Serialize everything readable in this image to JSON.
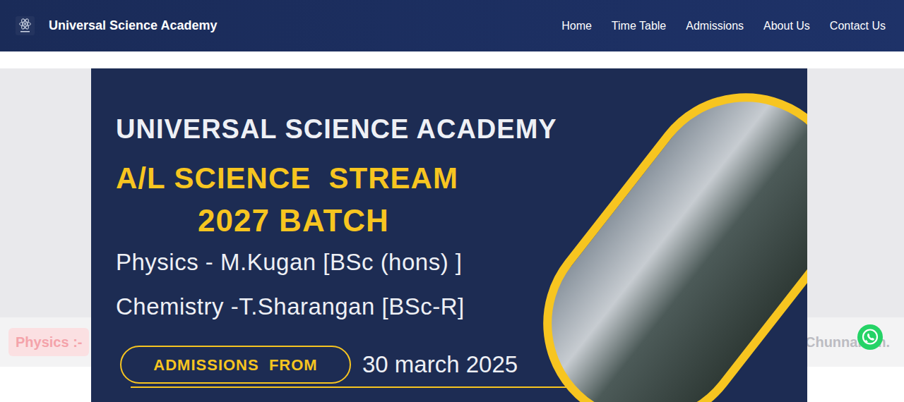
{
  "nav": {
    "brand": "Universal Science Academy",
    "links": [
      {
        "label": "Home"
      },
      {
        "label": "Time Table"
      },
      {
        "label": "Admissions"
      },
      {
        "label": "About Us"
      },
      {
        "label": "Contact Us"
      }
    ]
  },
  "marquee": {
    "badge": "Physics :-",
    "trailing": "Chunnakam."
  },
  "banner": {
    "title": "UNIVERSAL SCIENCE ACADEMY",
    "stream": "A/L SCIENCE  STREAM",
    "batch": "2027 BATCH",
    "teachers": [
      "Physics - M.Kugan [BSc (hons) ]",
      "Chemistry -T.Sharangan [BSc-R]"
    ],
    "admissions_label": "ADMISSIONS  FROM",
    "admissions_date": "30 march 2025"
  }
}
